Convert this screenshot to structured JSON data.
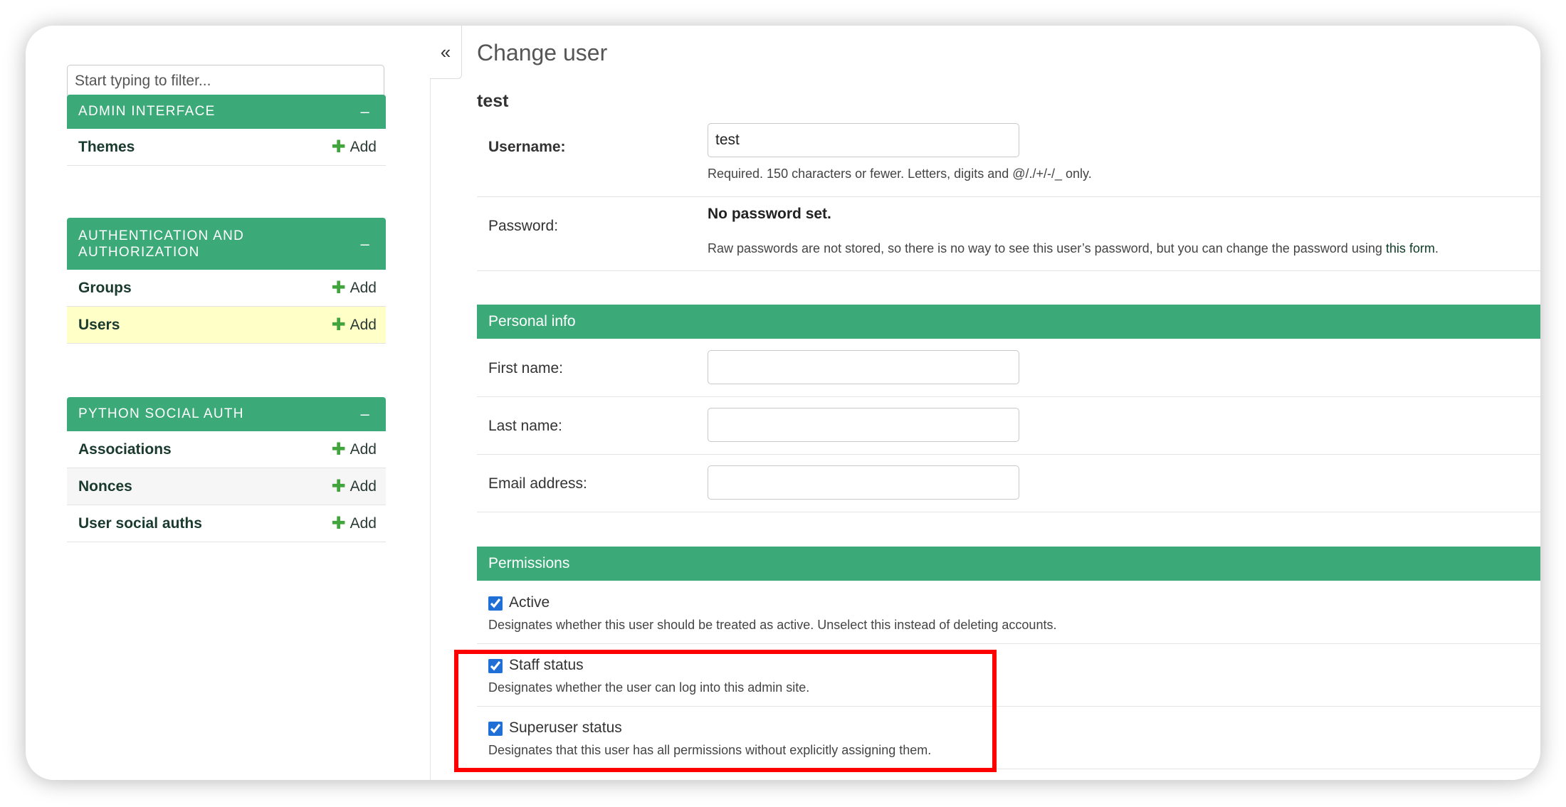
{
  "sidebar": {
    "filter_placeholder": "Start typing to filter...",
    "toggle_symbol": "–",
    "add_label": "Add",
    "add_symbol": "✚",
    "modules": [
      {
        "title": "ADMIN INTERFACE",
        "items": [
          {
            "name": "Themes"
          }
        ]
      },
      {
        "title": "AUTHENTICATION AND AUTHORIZATION",
        "items": [
          {
            "name": "Groups"
          },
          {
            "name": "Users",
            "selected": true
          }
        ]
      },
      {
        "title": "PYTHON SOCIAL AUTH",
        "items": [
          {
            "name": "Associations"
          },
          {
            "name": "Nonces"
          },
          {
            "name": "User social auths"
          }
        ]
      }
    ]
  },
  "collapse_symbol": "«",
  "main": {
    "title": "Change user",
    "object_name": "test",
    "username": {
      "label": "Username:",
      "value": "test",
      "help": "Required. 150 characters or fewer. Letters, digits and @/./+/-/_ only."
    },
    "password": {
      "label": "Password:",
      "status": "No password set.",
      "help": "Raw passwords are not stored, so there is no way to see this user’s password, but you can change the password using ",
      "link_text": "this form",
      "help_end": "."
    },
    "personal_info": {
      "heading": "Personal info",
      "first_name_label": "First name:",
      "first_name_value": "",
      "last_name_label": "Last name:",
      "last_name_value": "",
      "email_label": "Email address:",
      "email_value": ""
    },
    "permissions": {
      "heading": "Permissions",
      "items": [
        {
          "label": "Active",
          "checked": true,
          "help": "Designates whether this user should be treated as active. Unselect this instead of deleting accounts."
        },
        {
          "label": "Staff status",
          "checked": true,
          "help": "Designates whether the user can log into this admin site."
        },
        {
          "label": "Superuser status",
          "checked": true,
          "help": "Designates that this user has all permissions without explicitly assigning them."
        }
      ]
    }
  },
  "colors": {
    "header_green": "#3caa78",
    "add_green": "#42a43c",
    "selected_row": "#ffffc8",
    "annotation_red": "#ff0000"
  }
}
